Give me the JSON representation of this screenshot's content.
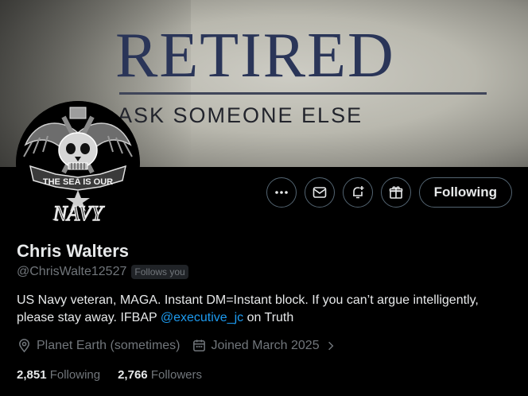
{
  "banner": {
    "title": "RETIRED",
    "subtitle": "ASK SOMEONE ELSE"
  },
  "avatar": {
    "description_icon": "navy-skull-emblem-icon",
    "text_top": "THE SEA IS OUR",
    "text_bottom": "NAVY"
  },
  "actions": {
    "more_icon": "more-icon",
    "message_icon": "envelope-icon",
    "subscribe_icon": "bell-plus-icon",
    "gift_icon": "gift-icon",
    "following_label": "Following"
  },
  "profile": {
    "name": "Chris Walters",
    "handle": "@ChrisWalte12527",
    "follows_you": "Follows you",
    "bio_text": "US Navy veteran, MAGA. Instant DM=Instant block. If you can’t argue intelligently, please stay away. IFBAP ",
    "bio_link": "@executive_jc",
    "bio_tail": " on Truth",
    "location": "Planet Earth (sometimes)",
    "joined": "Joined March 2025"
  },
  "stats": {
    "following_count": "2,851",
    "following_label": "Following",
    "followers_count": "2,766",
    "followers_label": "Followers"
  },
  "colors": {
    "link": "#1d9bf0",
    "muted": "#71767b",
    "text": "#e7e9ea",
    "border": "#536471"
  }
}
